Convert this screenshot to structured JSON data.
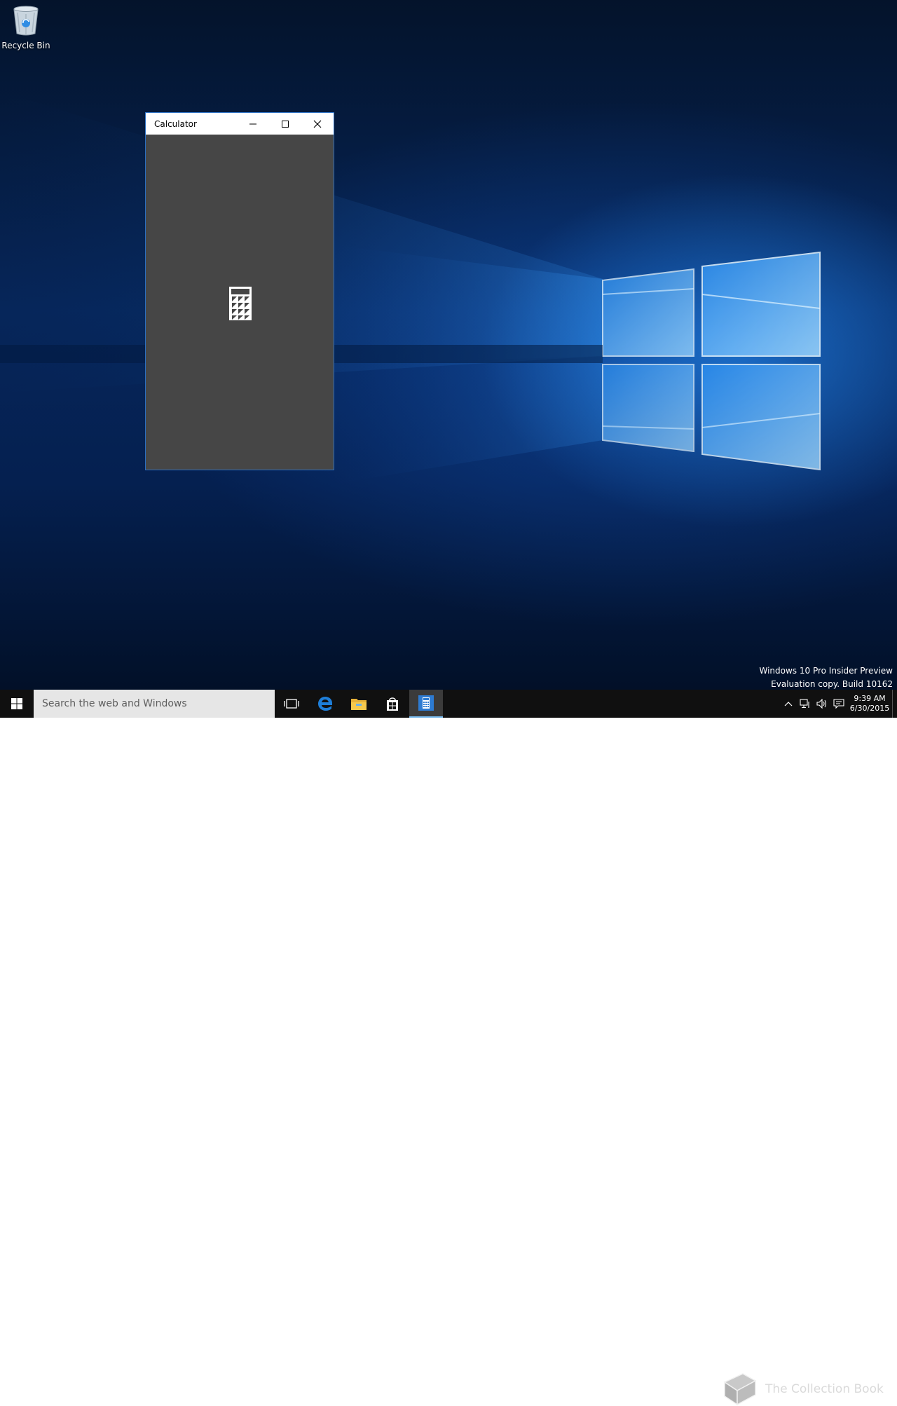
{
  "desktop": {
    "icons": [
      {
        "label": "Recycle Bin",
        "icon": "recycle-bin-icon"
      }
    ]
  },
  "window": {
    "title": "Calculator",
    "controls": {
      "minimize": "minimize-icon",
      "maximize": "maximize-icon",
      "close": "close-icon"
    },
    "splash_icon": "calculator-icon",
    "background_color": "#464646"
  },
  "watermark": {
    "line1": "Windows 10 Pro Insider Preview",
    "line2": "Evaluation copy. Build 10162"
  },
  "taskbar": {
    "search_placeholder": "Search the web and Windows",
    "pinned": [
      {
        "name": "task-view",
        "icon": "task-view-icon"
      },
      {
        "name": "edge",
        "icon": "edge-icon"
      },
      {
        "name": "file-explorer",
        "icon": "folder-icon"
      },
      {
        "name": "store",
        "icon": "store-icon"
      },
      {
        "name": "calculator",
        "icon": "calculator-icon",
        "active": true
      }
    ],
    "tray": {
      "icons": [
        "chevron-up-icon",
        "network-icon",
        "volume-icon",
        "action-center-icon"
      ],
      "time": "9:39 AM",
      "date": "6/30/2015"
    },
    "accent_color": "#76b9ed"
  },
  "brand_overlay": {
    "text": "The Collection Book",
    "icon": "book-icon"
  }
}
